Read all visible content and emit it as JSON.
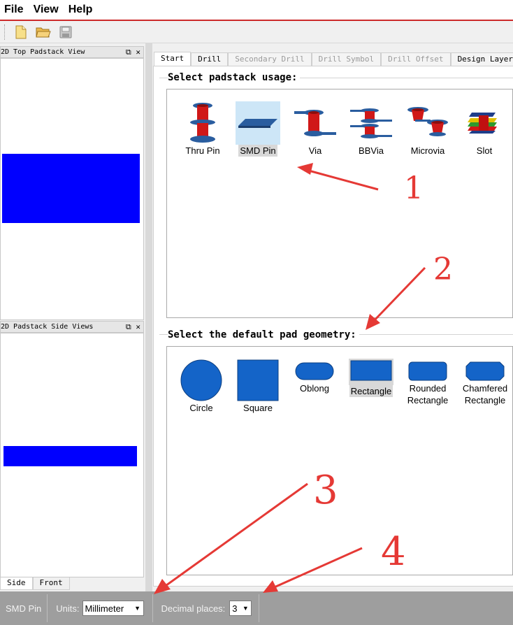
{
  "menu": {
    "items": [
      "File",
      "View",
      "Help"
    ]
  },
  "toolbar": {
    "buttons": [
      "new-file-icon",
      "open-folder-icon",
      "save-icon"
    ]
  },
  "left_panels": {
    "top_view": {
      "title": "2D Top Padstack View",
      "controls": "⧉ ✕"
    },
    "side_view": {
      "title": "2D Padstack Side Views",
      "controls": "⧉ ✕"
    },
    "view_tabs": [
      "Side",
      "Front"
    ],
    "pad_color": "#0000ff"
  },
  "tabs": [
    {
      "label": "Start",
      "state": "active"
    },
    {
      "label": "Drill",
      "state": "enabled"
    },
    {
      "label": "Secondary Drill",
      "state": "disabled"
    },
    {
      "label": "Drill Symbol",
      "state": "disabled"
    },
    {
      "label": "Drill Offset",
      "state": "disabled"
    },
    {
      "label": "Design Layers",
      "state": "enabled"
    }
  ],
  "usage": {
    "heading": "Select padstack usage:",
    "items": [
      "Thru Pin",
      "SMD Pin",
      "Via",
      "BBVia",
      "Microvia",
      "Slot"
    ],
    "selected": "SMD Pin"
  },
  "geometry": {
    "heading": "Select the default pad geometry:",
    "items": [
      "Circle",
      "Square",
      "Oblong",
      "Rectangle",
      "Rounded Rectangle",
      "Chamfered Rectangle"
    ],
    "selected": "Rectangle",
    "shape_color": "#1464c8"
  },
  "status": {
    "mode": "SMD Pin",
    "units_label": "Units:",
    "units_value": "Millimeter",
    "decimal_label": "Decimal places:",
    "decimal_value": "3"
  },
  "annotations": {
    "color": "#e53935",
    "numbers": [
      "1",
      "2",
      "3",
      "4"
    ]
  }
}
